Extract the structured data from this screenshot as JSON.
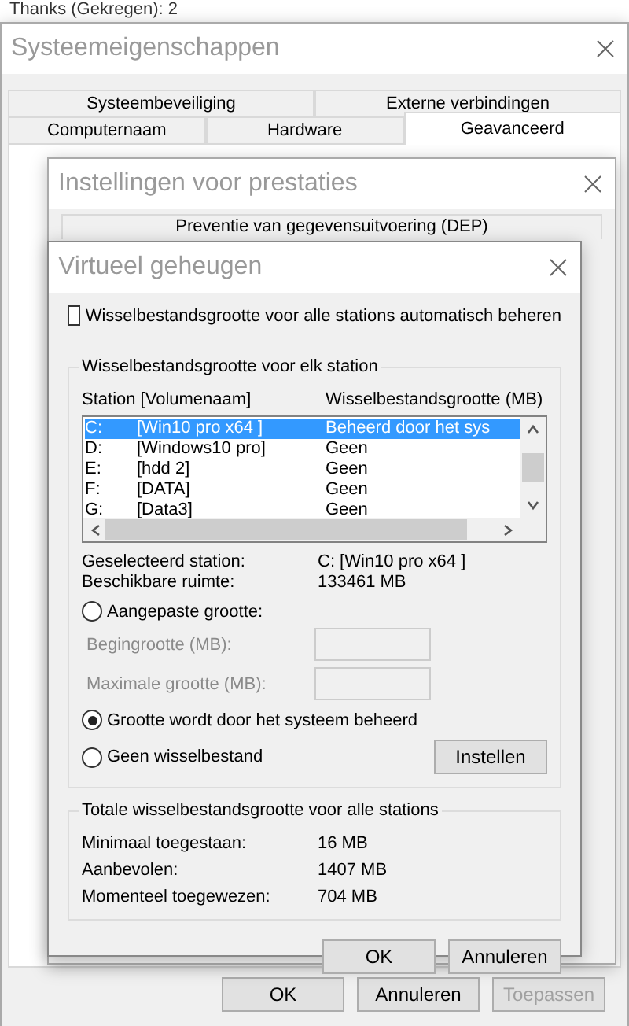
{
  "background": {
    "text": "Thanks (Gekregen):   2"
  },
  "system_window": {
    "title": "Systeemeigenschappen",
    "tab_rows": [
      {
        "tabs": [
          {
            "label": "Systeembeveiliging",
            "selected": false
          },
          {
            "label": "Externe verbindingen",
            "selected": false
          }
        ]
      },
      {
        "tabs": [
          {
            "label": "Computernaam",
            "selected": false
          },
          {
            "label": "Hardware",
            "selected": false
          },
          {
            "label": "Geavanceerd",
            "selected": true
          }
        ]
      }
    ],
    "buttons": [
      {
        "label": "OK",
        "disabled": false
      },
      {
        "label": "Annuleren",
        "disabled": false
      },
      {
        "label": "Toepassen",
        "disabled": true
      }
    ]
  },
  "performance_window": {
    "title": "Instellingen voor prestaties",
    "tab": {
      "label": "Preventie van gegevensuitvoering (DEP)"
    }
  },
  "vm_window": {
    "title": "Virtueel geheugen",
    "auto_manage": {
      "label": "Wisselbestandsgrootte voor alle stations automatisch beheren",
      "checked": false
    },
    "per_drive": {
      "legend": "Wisselbestandsgrootte voor elk station",
      "columns": [
        "Station [Volumenaam]",
        "Wisselbestandsgrootte (MB)"
      ],
      "rows": [
        {
          "drive": "C:",
          "volume": "[Win10 pro x64 ]",
          "size": "Beheerd door het sys",
          "selected": true
        },
        {
          "drive": "D:",
          "volume": "[Windows10 pro]",
          "size": "Geen",
          "selected": false
        },
        {
          "drive": "E:",
          "volume": "[hdd 2]",
          "size": "Geen",
          "selected": false
        },
        {
          "drive": "F:",
          "volume": "[DATA]",
          "size": "Geen",
          "selected": false
        },
        {
          "drive": "G:",
          "volume": "[Data3]",
          "size": "Geen",
          "selected": false
        }
      ],
      "info": [
        {
          "label": "Geselecteerd station:",
          "value": "C:  [Win10 pro x64 ]"
        },
        {
          "label": "Beschikbare ruimte:",
          "value": "133461 MB"
        }
      ],
      "controls": [
        {
          "kind": "radio",
          "label": "Aangepaste grootte:",
          "selected": false
        },
        {
          "kind": "field",
          "label": "Begingrootte (MB):",
          "disabled": true
        },
        {
          "kind": "field",
          "label": "Maximale grootte (MB):",
          "disabled": true
        },
        {
          "kind": "radio",
          "label": "Grootte wordt door het systeem beheerd",
          "selected": true
        },
        {
          "kind": "radio",
          "label": "Geen wisselbestand",
          "selected": false
        }
      ],
      "set_button": {
        "label": "Instellen"
      }
    },
    "totals": {
      "legend": "Totale wisselbestandsgrootte voor alle stations",
      "rows": [
        {
          "label": "Minimaal toegestaan:",
          "value": "16 MB"
        },
        {
          "label": "Aanbevolen:",
          "value": "1407 MB"
        },
        {
          "label": "Momenteel toegewezen:",
          "value": "704 MB"
        }
      ]
    },
    "buttons": [
      {
        "label": "OK"
      },
      {
        "label": "Annuleren"
      }
    ]
  }
}
